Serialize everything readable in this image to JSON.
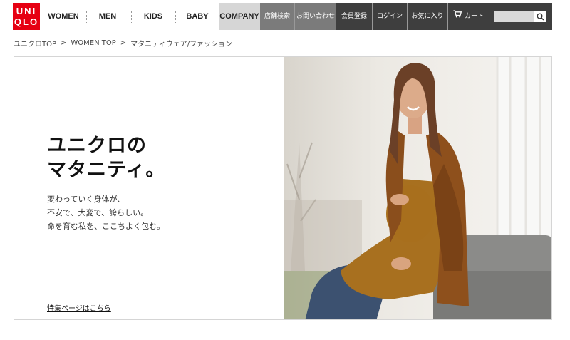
{
  "header": {
    "logo_line1": "UNI",
    "logo_line2": "QLO",
    "nav": {
      "women": "WOMEN",
      "men": "MEN",
      "kids": "KIDS",
      "baby": "BABY",
      "company": "COMPANY"
    },
    "utility": {
      "store_search": "店舗検索",
      "contact": "お問い合わせ",
      "register": "会員登録",
      "login": "ログイン",
      "favorites": "お気に入り",
      "cart": "カート"
    },
    "search_placeholder": ""
  },
  "breadcrumb": {
    "item1": "ユニクロTOP",
    "item2": "WOMEN TOP",
    "current": "マタニティウェア/ファッション",
    "separator": ">"
  },
  "banner": {
    "title_line1": "ユニクロの",
    "title_line2": "マタニティ。",
    "copy_line1": "変わっていく身体が、",
    "copy_line2": "不安で、大変で、誇らしい。",
    "copy_line3": "命を育む私を、ここちよく包む。",
    "link": "特集ページはこちら"
  },
  "colors": {
    "brand_red": "#e60012",
    "company_bg": "#d6d6d6",
    "util_light": "#7b7b7b",
    "util_dark": "#3e3e3e"
  },
  "icons": {
    "cart": "cart-icon",
    "search": "search-icon"
  }
}
